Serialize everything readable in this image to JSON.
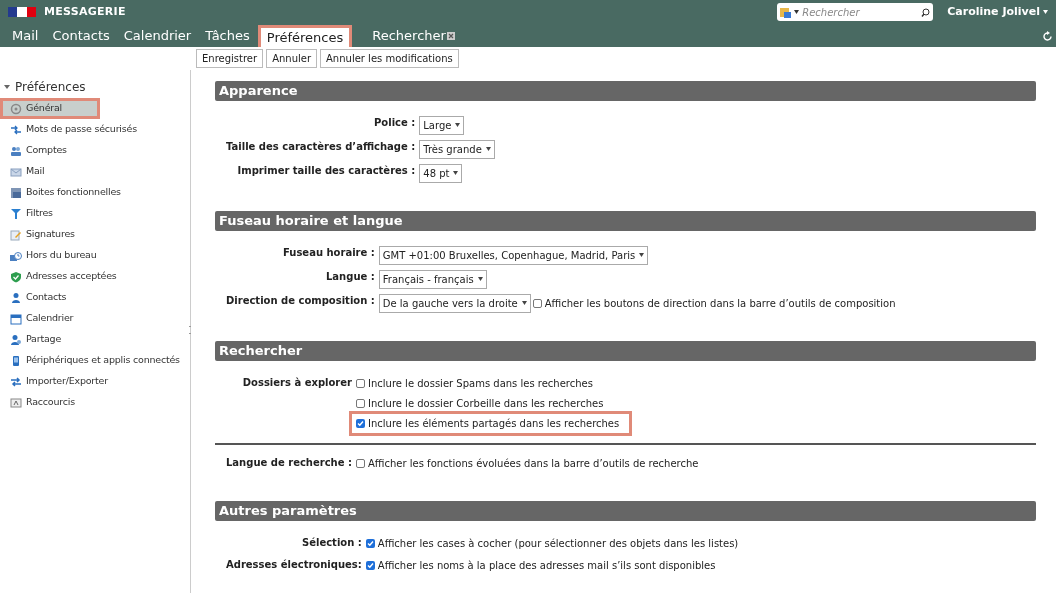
{
  "app": {
    "title": "MESSAGERIE"
  },
  "search": {
    "placeholder": "Rechercher"
  },
  "user": {
    "name": "Caroline Jolivel"
  },
  "tabs": [
    {
      "label": "Mail",
      "selected": false,
      "highlighted": false,
      "closable": false
    },
    {
      "label": "Contacts",
      "selected": false,
      "highlighted": false,
      "closable": false
    },
    {
      "label": "Calendrier",
      "selected": false,
      "highlighted": false,
      "closable": false
    },
    {
      "label": "Tâches",
      "selected": false,
      "highlighted": false,
      "closable": false
    },
    {
      "label": "Préférences",
      "selected": true,
      "highlighted": true,
      "closable": false
    },
    {
      "label": "Rechercher",
      "selected": false,
      "highlighted": false,
      "closable": true
    }
  ],
  "toolbar": {
    "buttons": [
      "Enregistrer",
      "Annuler",
      "Annuler les modifications"
    ]
  },
  "sidebar": {
    "title": "Préférences",
    "expanded": true,
    "items": [
      {
        "label": "Général",
        "selected": true,
        "highlighted": true
      },
      {
        "label": "Mots de passe sécurisés",
        "selected": false,
        "highlighted": false
      },
      {
        "label": "Comptes",
        "selected": false,
        "highlighted": false
      },
      {
        "label": "Mail",
        "selected": false,
        "highlighted": false
      },
      {
        "label": "Boites fonctionnelles",
        "selected": false,
        "highlighted": false
      },
      {
        "label": "Filtres",
        "selected": false,
        "highlighted": false
      },
      {
        "label": "Signatures",
        "selected": false,
        "highlighted": false
      },
      {
        "label": "Hors du bureau",
        "selected": false,
        "highlighted": false
      },
      {
        "label": "Adresses acceptées",
        "selected": false,
        "highlighted": false
      },
      {
        "label": "Contacts",
        "selected": false,
        "highlighted": false
      },
      {
        "label": "Calendrier",
        "selected": false,
        "highlighted": false
      },
      {
        "label": "Partage",
        "selected": false,
        "highlighted": false
      },
      {
        "label": "Périphériques et applis connectés",
        "selected": false,
        "highlighted": false
      },
      {
        "label": "Importer/Exporter",
        "selected": false,
        "highlighted": false
      },
      {
        "label": "Raccourcis",
        "selected": false,
        "highlighted": false
      }
    ]
  },
  "sections": [
    {
      "title": "Apparence",
      "rows": [
        {
          "kind": "select",
          "label": "Police :",
          "value": "Large"
        },
        {
          "kind": "select",
          "label": "Taille des caractères d’affichage :",
          "value": "Très grande"
        },
        {
          "kind": "select",
          "label": "Imprimer taille des caractères :",
          "value": "48 pt"
        }
      ]
    },
    {
      "title": "Fuseau horaire et langue",
      "rows": [
        {
          "kind": "select",
          "label": "Fuseau horaire :",
          "value": "GMT +01:00 Bruxelles, Copenhague, Madrid, Paris"
        },
        {
          "kind": "select",
          "label": "Langue :",
          "value": "Français - français"
        },
        {
          "kind": "select",
          "label": "Direction de composition :",
          "value": "De la gauche vers la droite",
          "option": {
            "label": "Afficher les boutons de direction dans la barre d’outils de composition",
            "checked": false,
            "highlighted": false
          }
        }
      ]
    },
    {
      "title": "Rechercher",
      "rows": [
        {
          "kind": "checkboxes",
          "label": "Dossiers à explorer",
          "options": [
            {
              "label": "Inclure le dossier Spams dans les recherches",
              "checked": false,
              "highlighted": false
            },
            {
              "label": "Inclure le dossier Corbeille dans les recherches",
              "checked": false,
              "highlighted": false
            },
            {
              "label": "Inclure les éléments partagés dans les recherches",
              "checked": true,
              "highlighted": true
            }
          ]
        },
        {
          "kind": "divider"
        },
        {
          "kind": "checkboxes",
          "label": "Langue de recherche :",
          "options": [
            {
              "label": "Afficher les fonctions évoluées dans la barre d’outils de recherche",
              "checked": false,
              "highlighted": false
            }
          ]
        }
      ]
    },
    {
      "title": "Autres paramètres",
      "rows": [
        {
          "kind": "checkboxes",
          "label": "Sélection :",
          "options": [
            {
              "label": "Afficher les cases à cocher (pour sélectionner des objets dans les listes)",
              "checked": true,
              "highlighted": false
            }
          ]
        },
        {
          "kind": "checkboxes",
          "label": "Adresses électroniques:",
          "options": [
            {
              "label": "Afficher les noms à la place des adresses mail s’ils sont disponibles",
              "checked": true,
              "highlighted": false
            }
          ]
        }
      ]
    }
  ]
}
